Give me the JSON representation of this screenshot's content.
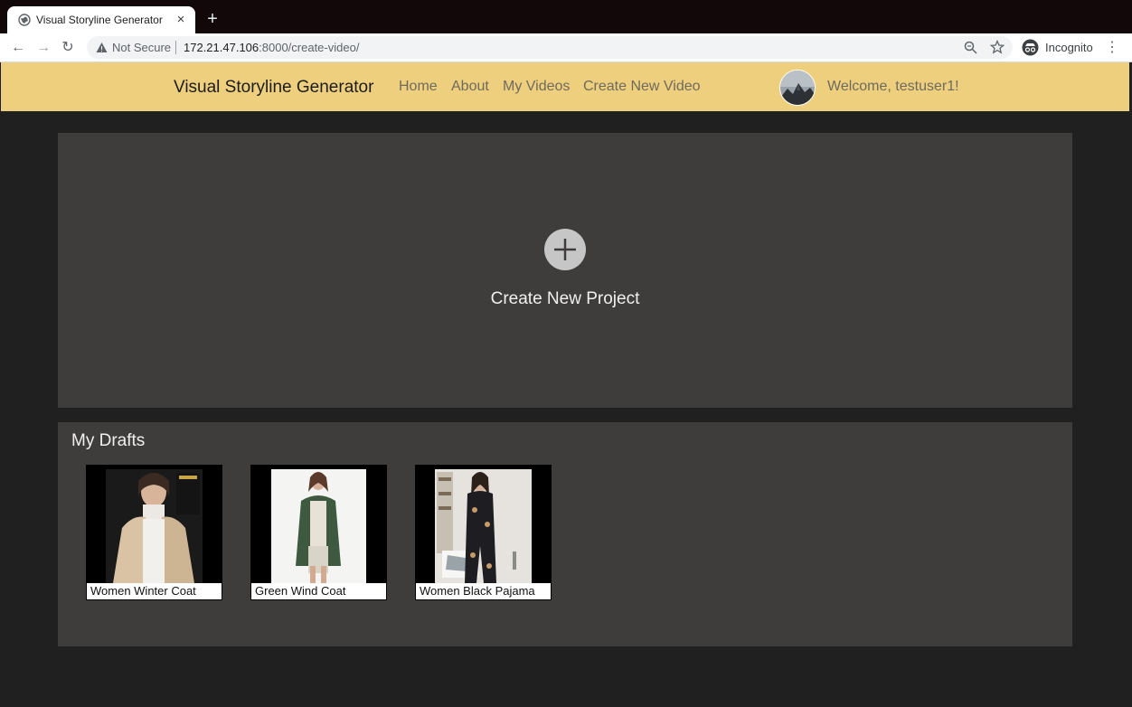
{
  "browser": {
    "tab_title": "Visual Storyline Generator",
    "tab_close": "×",
    "new_tab": "+",
    "security_label": "Not Secure",
    "url_host": "172.21.47.106",
    "url_rest": ":8000/create-video/",
    "incognito_label": "Incognito",
    "back": "←",
    "forward": "→",
    "reload": "↻",
    "menu": "⋮"
  },
  "header": {
    "brand": "Visual Storyline Generator",
    "nav": [
      "Home",
      "About",
      "My Videos",
      "Create New Video"
    ],
    "welcome": "Welcome, testuser1!"
  },
  "create": {
    "label": "Create New Project"
  },
  "drafts": {
    "title": "My Drafts",
    "items": [
      {
        "label": "Women Winter Coat"
      },
      {
        "label": "Green Wind Coat"
      },
      {
        "label": "Women Black Pajama"
      }
    ]
  },
  "colors": {
    "header_bg": "#eecf7d",
    "page_bg": "#202020",
    "panel_bg": "#3e3d3c"
  }
}
